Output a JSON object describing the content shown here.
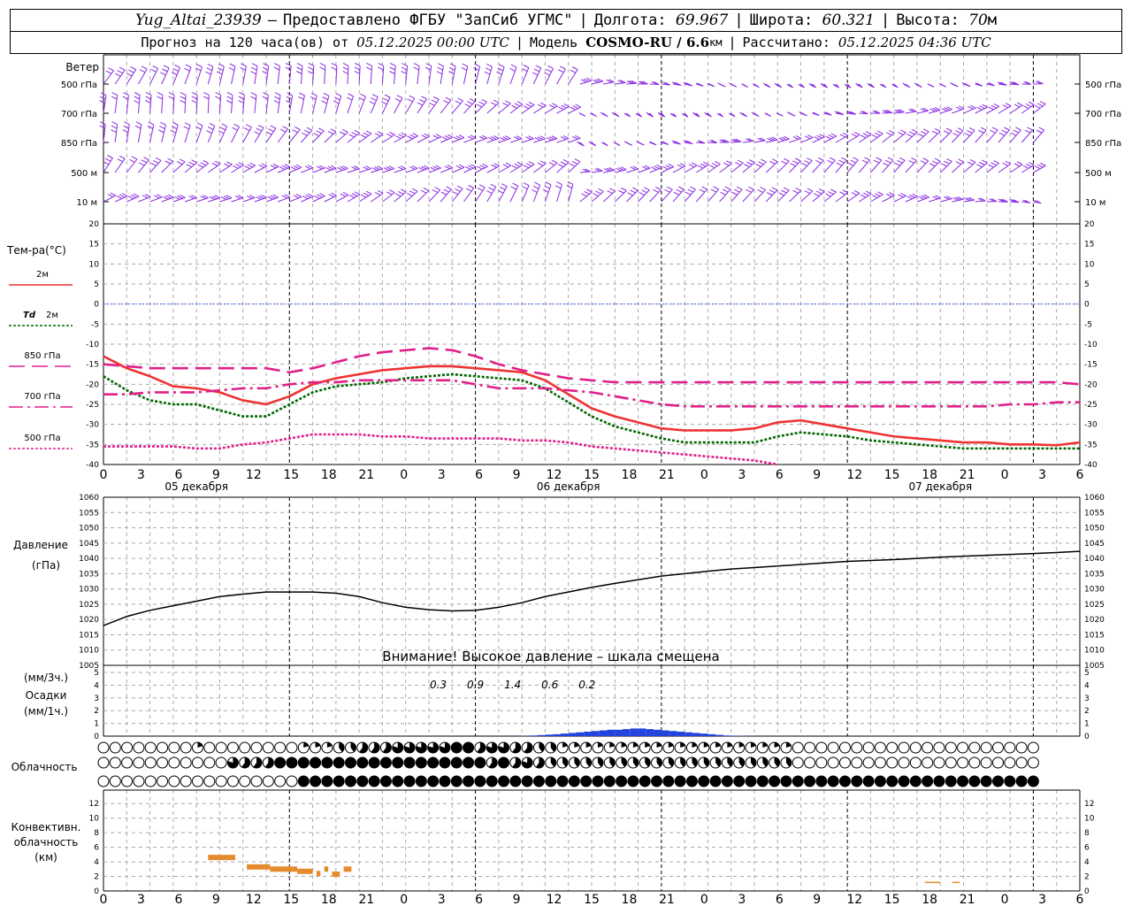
{
  "header": {
    "station": "Yug_Altai_23939",
    "dash": "–",
    "provider": "Предоставлено ФГБУ \"ЗапСиб УГМС\"",
    "lon_label": "Долгота:",
    "lon": "69.967",
    "lat_label": "Широта:",
    "lat": "60.321",
    "alt_label": "Высота:",
    "alt_value": "70",
    "alt_unit": "м",
    "forecast_label": "Прогноз на 120 часа(ов) от",
    "forecast_time": "05.12.2025 00:00 UTC",
    "model_label": "Модель",
    "model": "COSMO-RU / 6.6",
    "model_unit": "км",
    "calc_label": "Рассчитано:",
    "calc_time": "05.12.2025 04:36 UTC"
  },
  "chart_data": {
    "type": "meteogram",
    "x_axis": {
      "tick_labels": [
        "0",
        "3",
        "6",
        "9",
        "12",
        "15",
        "18",
        "21",
        "0",
        "3",
        "6",
        "9",
        "12",
        "15",
        "18",
        "21",
        "0",
        "3",
        "6",
        "9",
        "12",
        "15",
        "18",
        "21",
        "0",
        "3",
        "6"
      ],
      "day_labels": [
        "05 декабря",
        "06 декабря",
        "07 декабря"
      ]
    },
    "wind": {
      "title": "Ветер",
      "levels": [
        "500 гПа",
        "700 гПа",
        "850 гПа",
        "500 м",
        "10 м"
      ],
      "color": "#8a2be2"
    },
    "temperature": {
      "title": "Тем-ра(°С)",
      "ylim": [
        -40,
        20
      ],
      "ticks": [
        20,
        15,
        10,
        5,
        0,
        -5,
        -10,
        -15,
        -20,
        -25,
        -30,
        -35,
        -40
      ],
      "series": [
        {
          "name": "2м",
          "color": "#ee3333",
          "dash": "solid",
          "values": [
            -13,
            -16,
            -18,
            -20.5,
            -21,
            -22,
            -24,
            -25,
            -23,
            -20,
            -18.5,
            -17.5,
            -16.5,
            -16,
            -15.5,
            -15.5,
            -16,
            -16.5,
            -17,
            -19,
            -22.5,
            -26,
            -28,
            -29.5,
            -31,
            -31.5,
            -31.5,
            -31.5,
            -31,
            -29.5,
            -29,
            -30,
            -31,
            -32,
            -33,
            -33.5,
            -34,
            -34.5,
            -34.5,
            -35,
            -35,
            -35.2,
            -34.5
          ]
        },
        {
          "name_prefix": "Td",
          "name": "2м",
          "color": "#006600",
          "dash": "dot",
          "values": [
            -18,
            -21.5,
            -24,
            -25,
            -25,
            -26.5,
            -28,
            -28,
            -25,
            -22,
            -20.5,
            -20,
            -19.5,
            -18.5,
            -18,
            -17.5,
            -18,
            -18.5,
            -19,
            -21,
            -24.5,
            -28,
            -30.5,
            -32,
            -33.5,
            -34.5,
            -34.5,
            -34.5,
            -34.5,
            -33,
            -32,
            -32.5,
            -33,
            -34,
            -34.5,
            -35,
            -35.5,
            -36,
            -36,
            -36,
            -36,
            -36,
            -36
          ]
        },
        {
          "name": "850 гПа",
          "color": "#e0208a",
          "dash": "long",
          "values": [
            -15,
            -15.5,
            -16,
            -16,
            -16,
            -16,
            -16,
            -16,
            -17,
            -16,
            -14.5,
            -13,
            -12,
            -11.5,
            -11,
            -11.5,
            -13,
            -15,
            -16.5,
            -17.5,
            -18.5,
            -19,
            -19.5,
            -19.5,
            -19.5,
            -19.5,
            -19.5,
            -19.5,
            -19.5,
            -19.5,
            -19.5,
            -19.5,
            -19.5,
            -19.5,
            -19.5,
            -19.5,
            -19.5,
            -19.5,
            -19.5,
            -19.5,
            -19.5,
            -19.5,
            -20
          ]
        },
        {
          "name": "700 гПа",
          "color": "#e0208a",
          "dash": "dashdot",
          "values": [
            -22.5,
            -22.5,
            -22,
            -22,
            -22,
            -21.5,
            -21,
            -21,
            -20,
            -19.5,
            -19.5,
            -19,
            -19,
            -19,
            -19,
            -19,
            -20,
            -21,
            -21,
            -21,
            -21.5,
            -22,
            -23,
            -24,
            -25,
            -25.5,
            -25.5,
            -25.5,
            -25.5,
            -25.5,
            -25.5,
            -25.5,
            -25.5,
            -25.5,
            -25.5,
            -25.5,
            -25.5,
            -25.5,
            -25.5,
            -25,
            -25,
            -24.5,
            -24.5
          ]
        },
        {
          "name": "500 гПа",
          "color": "#e0208a",
          "dash": "dot",
          "values": [
            -35.5,
            -35.5,
            -35.5,
            -35.5,
            -36,
            -36,
            -35,
            -34.5,
            -33.5,
            -32.5,
            -32.5,
            -32.5,
            -33,
            -33,
            -33.5,
            -33.5,
            -33.5,
            -33.5,
            -34,
            -34,
            -34.5,
            -35.5,
            -36,
            -36.5,
            -37,
            -37.5,
            -38,
            -38.5,
            -39,
            -40
          ]
        }
      ]
    },
    "pressure": {
      "title": "Давление",
      "unit": "(гПа)",
      "ylim": [
        1005,
        1060
      ],
      "ticks": [
        1060,
        1055,
        1050,
        1045,
        1040,
        1035,
        1030,
        1025,
        1020,
        1015,
        1010,
        1005
      ],
      "values": [
        1018,
        1021,
        1023,
        1024.5,
        1026,
        1027.5,
        1028.3,
        1029,
        1029,
        1029,
        1028.6,
        1027.5,
        1025.5,
        1024,
        1023.2,
        1022.8,
        1023,
        1024,
        1025.5,
        1027.5,
        1029,
        1030.5,
        1031.8,
        1033,
        1034.2,
        1035,
        1035.8,
        1036.5,
        1037,
        1037.5,
        1038,
        1038.5,
        1039,
        1039.3,
        1039.6,
        1040,
        1040.4,
        1040.7,
        1041,
        1041.3,
        1041.6,
        1041.9,
        1042.3
      ],
      "color": "#000000",
      "warning": "Внимание! Высокое давление – шкала смещена"
    },
    "precipitation": {
      "unit_top": "(мм/3ч.)",
      "title": "Осадки",
      "unit_bottom": "(мм/1ч.)",
      "ylim": [
        0,
        5
      ],
      "ticks": [
        5,
        4,
        3,
        2,
        1,
        0
      ],
      "labels": [
        {
          "step": 18,
          "text": "0.3"
        },
        {
          "step": 20,
          "text": "0.9"
        },
        {
          "step": 22,
          "text": "1.4"
        },
        {
          "step": 24,
          "text": "0.6"
        },
        {
          "step": 26,
          "text": "0.2"
        }
      ],
      "hourly": [
        0,
        0,
        0,
        0,
        0,
        0,
        0,
        0,
        0,
        0,
        0,
        0,
        0,
        0,
        0,
        0,
        0,
        0,
        0,
        0,
        0,
        0,
        0,
        0,
        0,
        0,
        0,
        0,
        0,
        0,
        0,
        0,
        0,
        0,
        0,
        0,
        0,
        0,
        0,
        0,
        0,
        0,
        0,
        0,
        0,
        0,
        0,
        0,
        0,
        0,
        0,
        0,
        0,
        0,
        0.02,
        0.05,
        0.08,
        0.12,
        0.15,
        0.2,
        0.25,
        0.3,
        0.35,
        0.4,
        0.45,
        0.5,
        0.5,
        0.55,
        0.6,
        0.6,
        0.55,
        0.5,
        0.45,
        0.4,
        0.35,
        0.3,
        0.25,
        0.2,
        0.15,
        0.1,
        0.05,
        0.03,
        0.02,
        0.01,
        0,
        0,
        0,
        0,
        0,
        0,
        0,
        0,
        0,
        0,
        0,
        0,
        0,
        0,
        0,
        0,
        0,
        0,
        0,
        0,
        0,
        0,
        0,
        0,
        0,
        0,
        0,
        0,
        0,
        0,
        0,
        0,
        0,
        0,
        0,
        0,
        0,
        0,
        0,
        0,
        0,
        0,
        0,
        0,
        0,
        0,
        0,
        0,
        0,
        0,
        0,
        0
      ],
      "color": "#2244dd"
    },
    "cloudiness": {
      "title": "Облачность",
      "rows": [
        "00000000100000000111223334444456344332211111111111111111111000000000000000000000",
        "00000000000433355555555555555555535343222222222222222222222000000000000000000000",
        "00000000000000000555555555555555555555555555555555555555555555555555555555555555"
      ]
    },
    "convective": {
      "title_lines": [
        "Конвективн.",
        "облачность",
        "(км)"
      ],
      "ylim": [
        0,
        13
      ],
      "ticks": [
        12,
        10,
        8,
        6,
        4,
        2,
        0
      ],
      "color": "#e68a2e",
      "segments": [
        {
          "h0": 13.5,
          "h1": 17,
          "alt": 4.6
        },
        {
          "h0": 18.5,
          "h1": 21.5,
          "alt": 3.3
        },
        {
          "h0": 21.5,
          "h1": 25,
          "alt": 3.0
        },
        {
          "h0": 25,
          "h1": 27,
          "alt": 2.7
        },
        {
          "h0": 27.5,
          "h1": 28,
          "alt": 2.4
        },
        {
          "h0": 28.5,
          "h1": 29,
          "alt": 3.0
        },
        {
          "h0": 29.5,
          "h1": 30.5,
          "alt": 2.3
        },
        {
          "h0": 31,
          "h1": 32,
          "alt": 3.0
        },
        {
          "h0": 106,
          "h1": 108,
          "alt": 0.9
        },
        {
          "h0": 109.5,
          "h1": 110.5,
          "alt": 0.9
        }
      ]
    }
  }
}
